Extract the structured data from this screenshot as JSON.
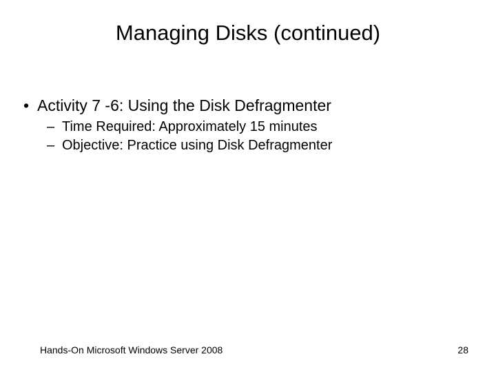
{
  "title": "Managing Disks (continued)",
  "bullets": {
    "l1": {
      "marker": "•",
      "text": "Activity 7 -6: Using the Disk Defragmenter"
    },
    "l2a": {
      "marker": "–",
      "text": "Time Required: Approximately 15 minutes"
    },
    "l2b": {
      "marker": "–",
      "text": "Objective: Practice using Disk Defragmenter"
    }
  },
  "footer": {
    "left": "Hands-On Microsoft Windows Server 2008",
    "right": "28"
  }
}
